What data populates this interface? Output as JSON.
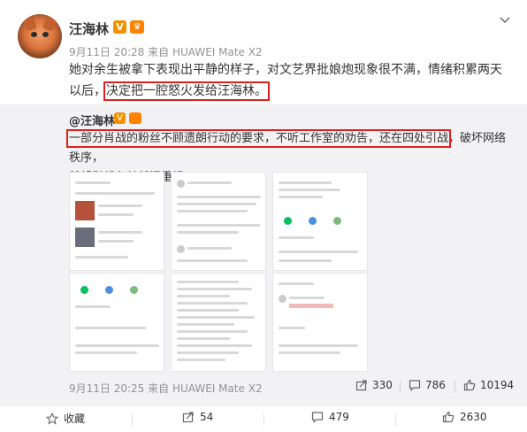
{
  "post": {
    "username": "汪海林",
    "verified_badge": "V",
    "time": "9月11日 20:28",
    "source_prefix": "来自",
    "device": "HUAWEI Mate X2",
    "text_line1": "她对余生被拿下表现出平静的样子，对文艺界批娘炮现象很不满，情绪积累两天",
    "text_line2_pre": "以后，",
    "text_line2_highlight": "决定把一腔怒火发给汪海林。"
  },
  "repost": {
    "user": "@汪海林",
    "verified_badge": "V",
    "text_highlight": "一部分肖战的粉丝不顾遗朗行动的要求，不听工作室的劝告，还在四处引战",
    "text_rest": "，破坏网络秩序，",
    "text_line2": "希望引起有关部门重视。",
    "time": "9月11日 20:25",
    "source_prefix": "来自",
    "device": "HUAWEI Mate X2",
    "share_count": "330",
    "comment_count": "786",
    "like_count": "10194"
  },
  "actions": {
    "favorite_label": "收藏",
    "share_count": "54",
    "comment_count": "479",
    "like_count": "2630"
  },
  "colors": {
    "highlight_box": "#e02020",
    "verified": "#f29100",
    "meta_text": "#939393",
    "repost_bg": "#f2f2f5"
  },
  "icons": [
    "chevron-down-icon",
    "share-icon",
    "comment-icon",
    "like-icon",
    "star-icon"
  ]
}
